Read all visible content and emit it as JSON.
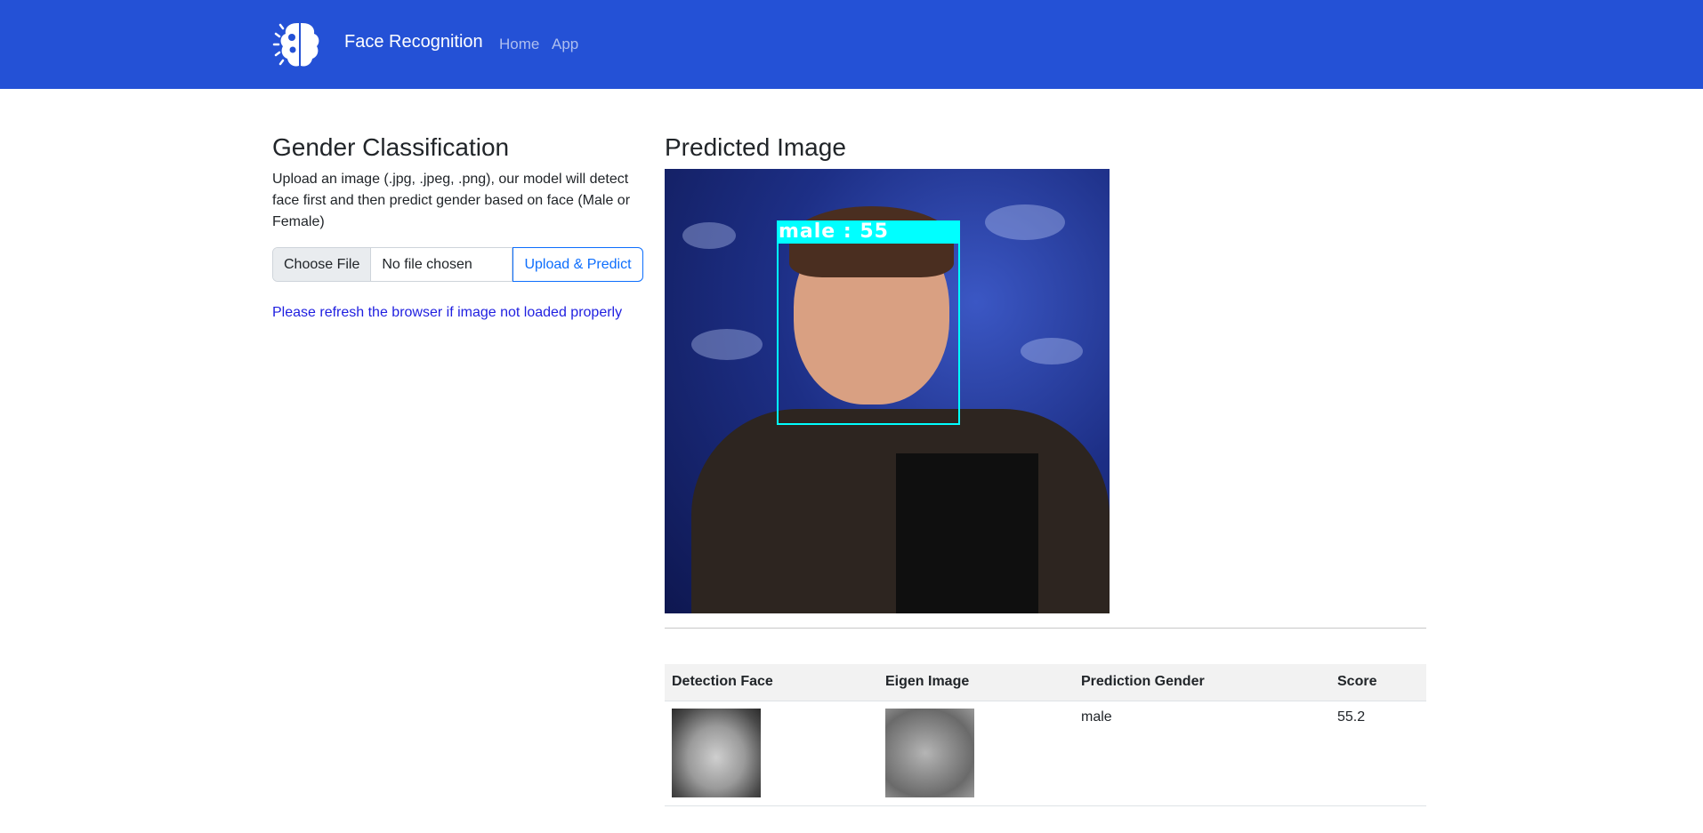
{
  "nav": {
    "brand": "Face Recognition",
    "links": [
      {
        "label": "Home"
      },
      {
        "label": "App"
      }
    ]
  },
  "left": {
    "title": "Gender Classification",
    "description": "Upload an image (.jpg, .jpeg, .png), our model will detect face first and then predict gender based on face (Male or Female)",
    "choose_file_label": "Choose File",
    "file_status": "No file chosen",
    "upload_label": "Upload & Predict",
    "refresh_note": "Please refresh the browser if image not loaded properly"
  },
  "right": {
    "title": "Predicted Image",
    "face_label": "male : 55"
  },
  "table": {
    "headers": [
      "Detection Face",
      "Eigen Image",
      "Prediction Gender",
      "Score"
    ],
    "rows": [
      {
        "gender": "male",
        "score": "55.2"
      }
    ]
  },
  "colors": {
    "navbar": "#2451d6",
    "accent": "#0d6efd",
    "face_box": "#00ffff",
    "note": "#1f1fe0"
  }
}
